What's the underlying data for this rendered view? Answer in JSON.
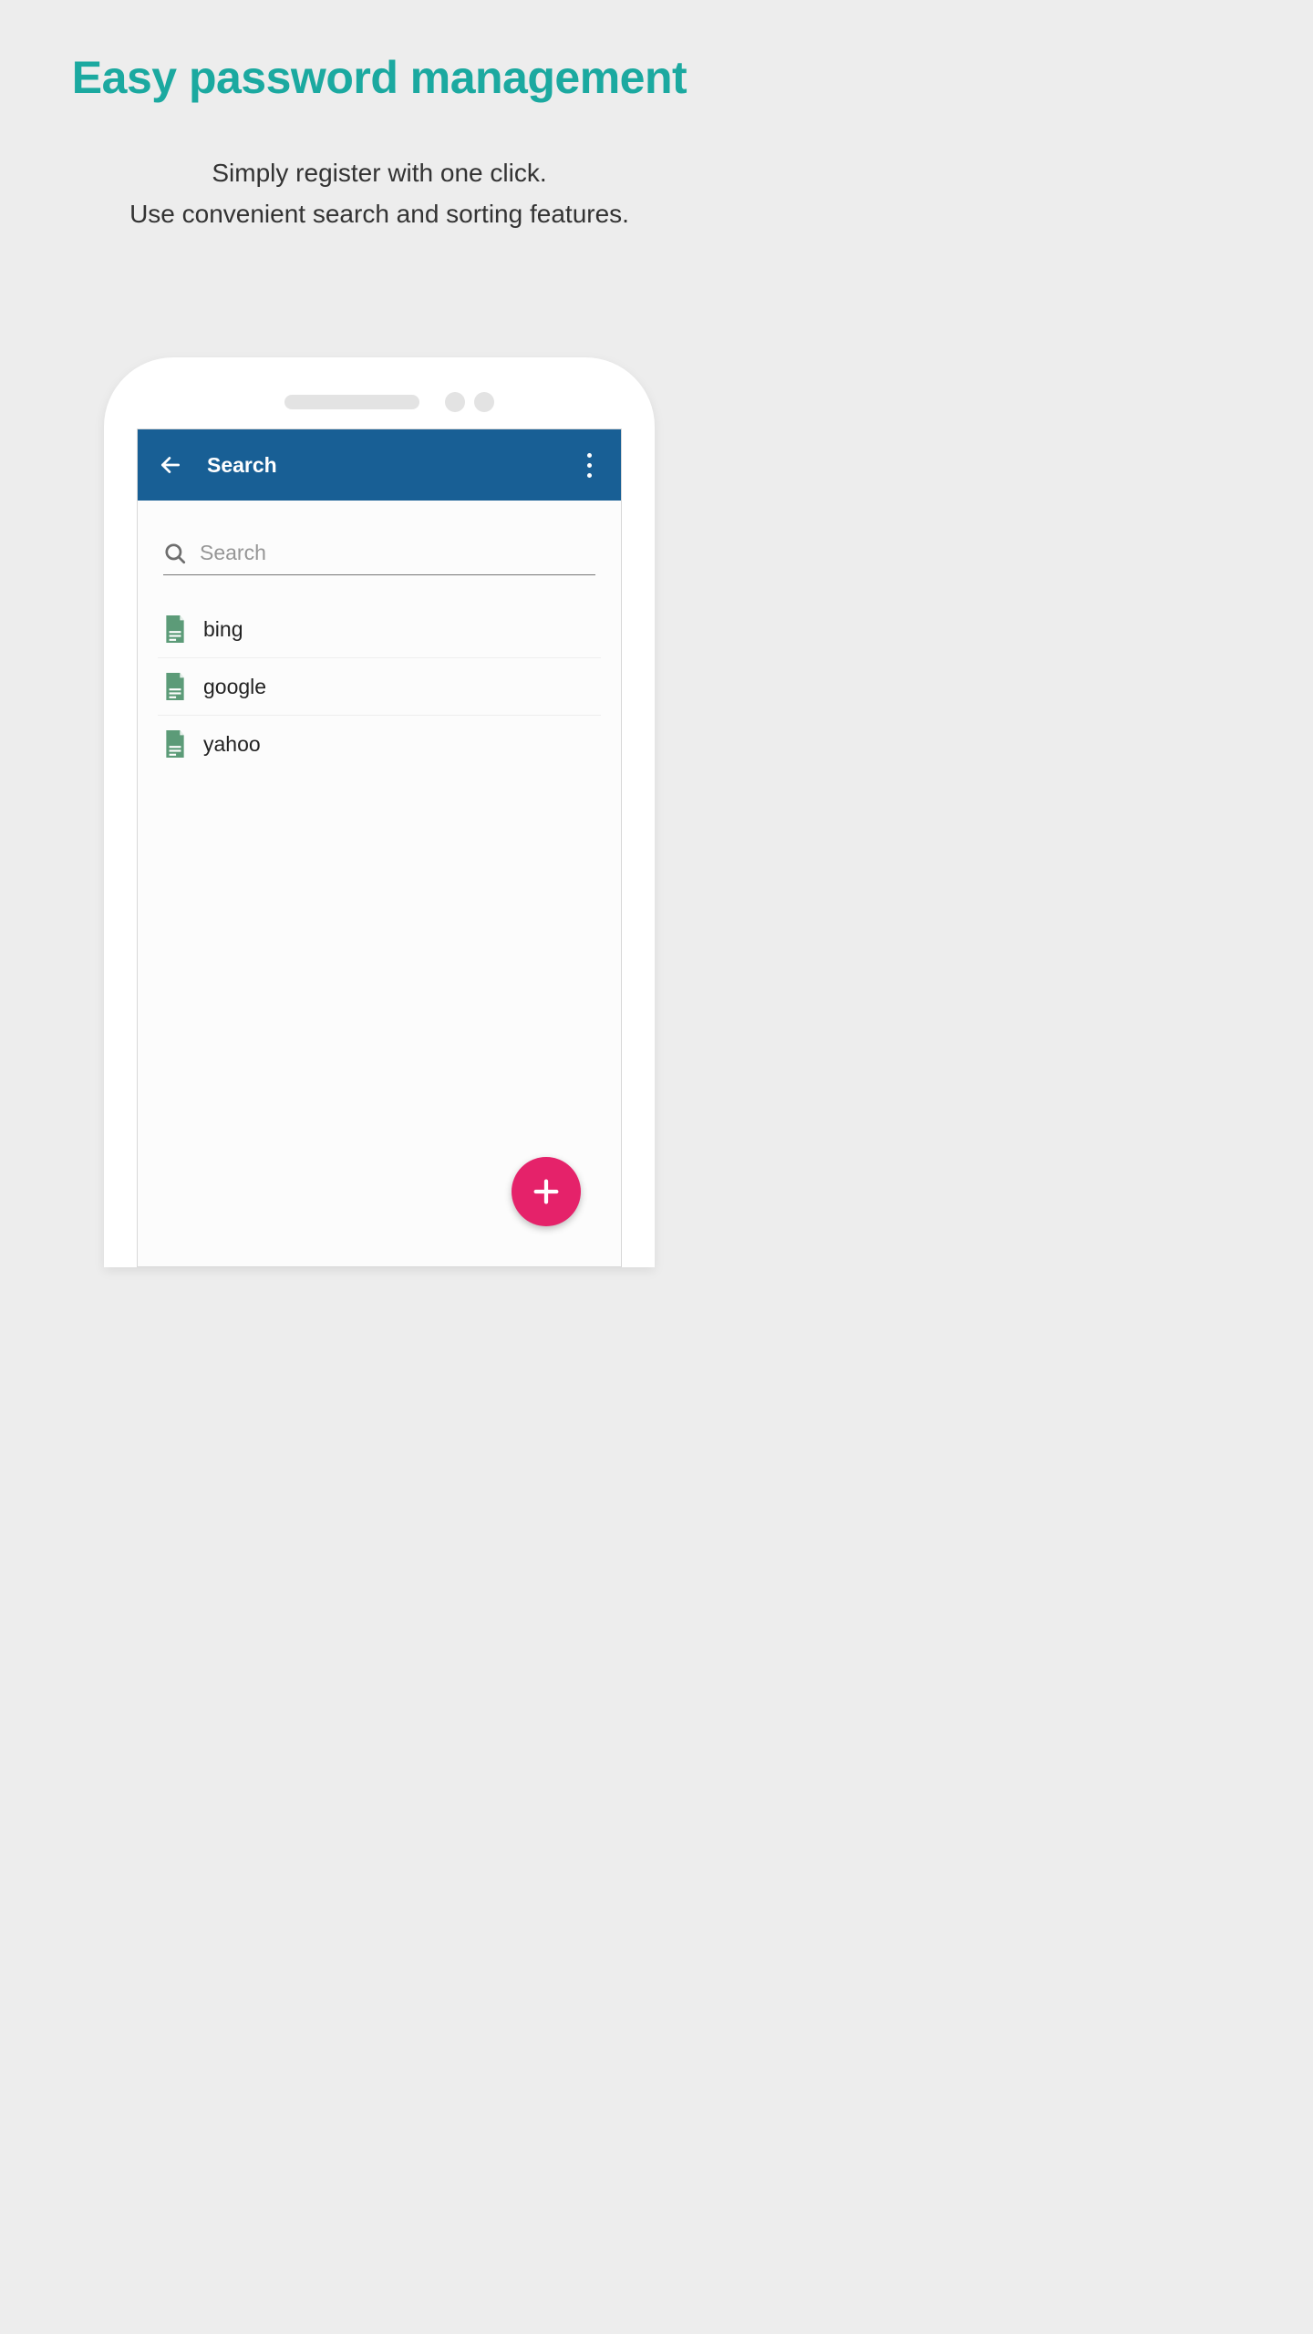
{
  "page": {
    "title": "Easy password management",
    "subtitle_line1": "Simply register with one click.",
    "subtitle_line2": "Use convenient search and sorting features."
  },
  "app": {
    "bar_title": "Search",
    "search_placeholder": "Search",
    "items": [
      {
        "label": "bing"
      },
      {
        "label": "google"
      },
      {
        "label": "yahoo"
      }
    ]
  },
  "colors": {
    "accent": "#1ba9a0",
    "appbar": "#185f95",
    "fab": "#e5226a",
    "doc_icon": "#5c9b78"
  }
}
